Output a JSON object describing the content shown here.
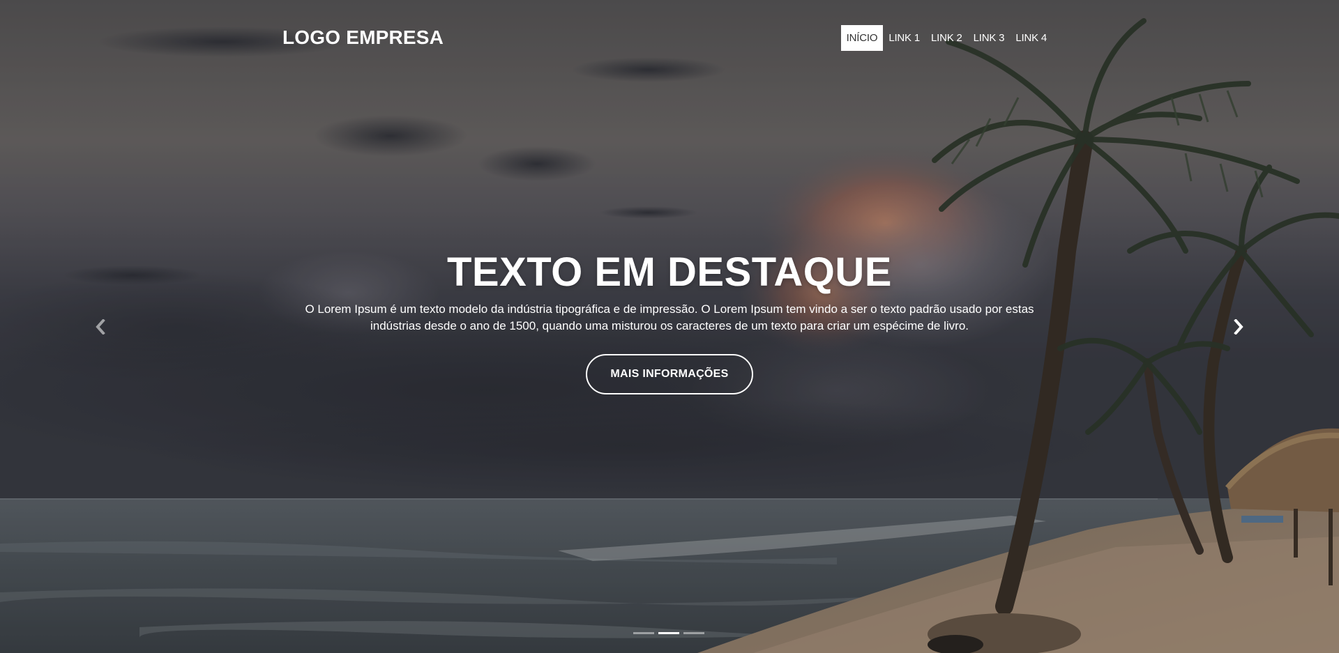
{
  "header": {
    "logo": "LOGO EMPRESA",
    "nav": [
      {
        "label": "INÍCIO",
        "active": true
      },
      {
        "label": "LINK 1",
        "active": false
      },
      {
        "label": "LINK 2",
        "active": false
      },
      {
        "label": "LINK 3",
        "active": false
      },
      {
        "label": "LINK 4",
        "active": false
      }
    ]
  },
  "hero": {
    "headline": "TEXTO EM DESTAQUE",
    "description": "O Lorem Ipsum é um texto modelo da indústria tipográfica e de impressão. O Lorem Ipsum tem vindo a ser o texto padrão usado por estas indústrias desde o ano de 1500, quando uma misturou os caracteres de um texto para criar um espécime de livro.",
    "cta_label": "MAIS INFORMAÇÕES"
  },
  "carousel": {
    "prev_icon": "chevron-left-icon",
    "next_icon": "chevron-right-icon",
    "slide_count": 3,
    "active_slide": 2
  },
  "colors": {
    "accent": "#ffffff",
    "active_nav_text": "#333333"
  }
}
